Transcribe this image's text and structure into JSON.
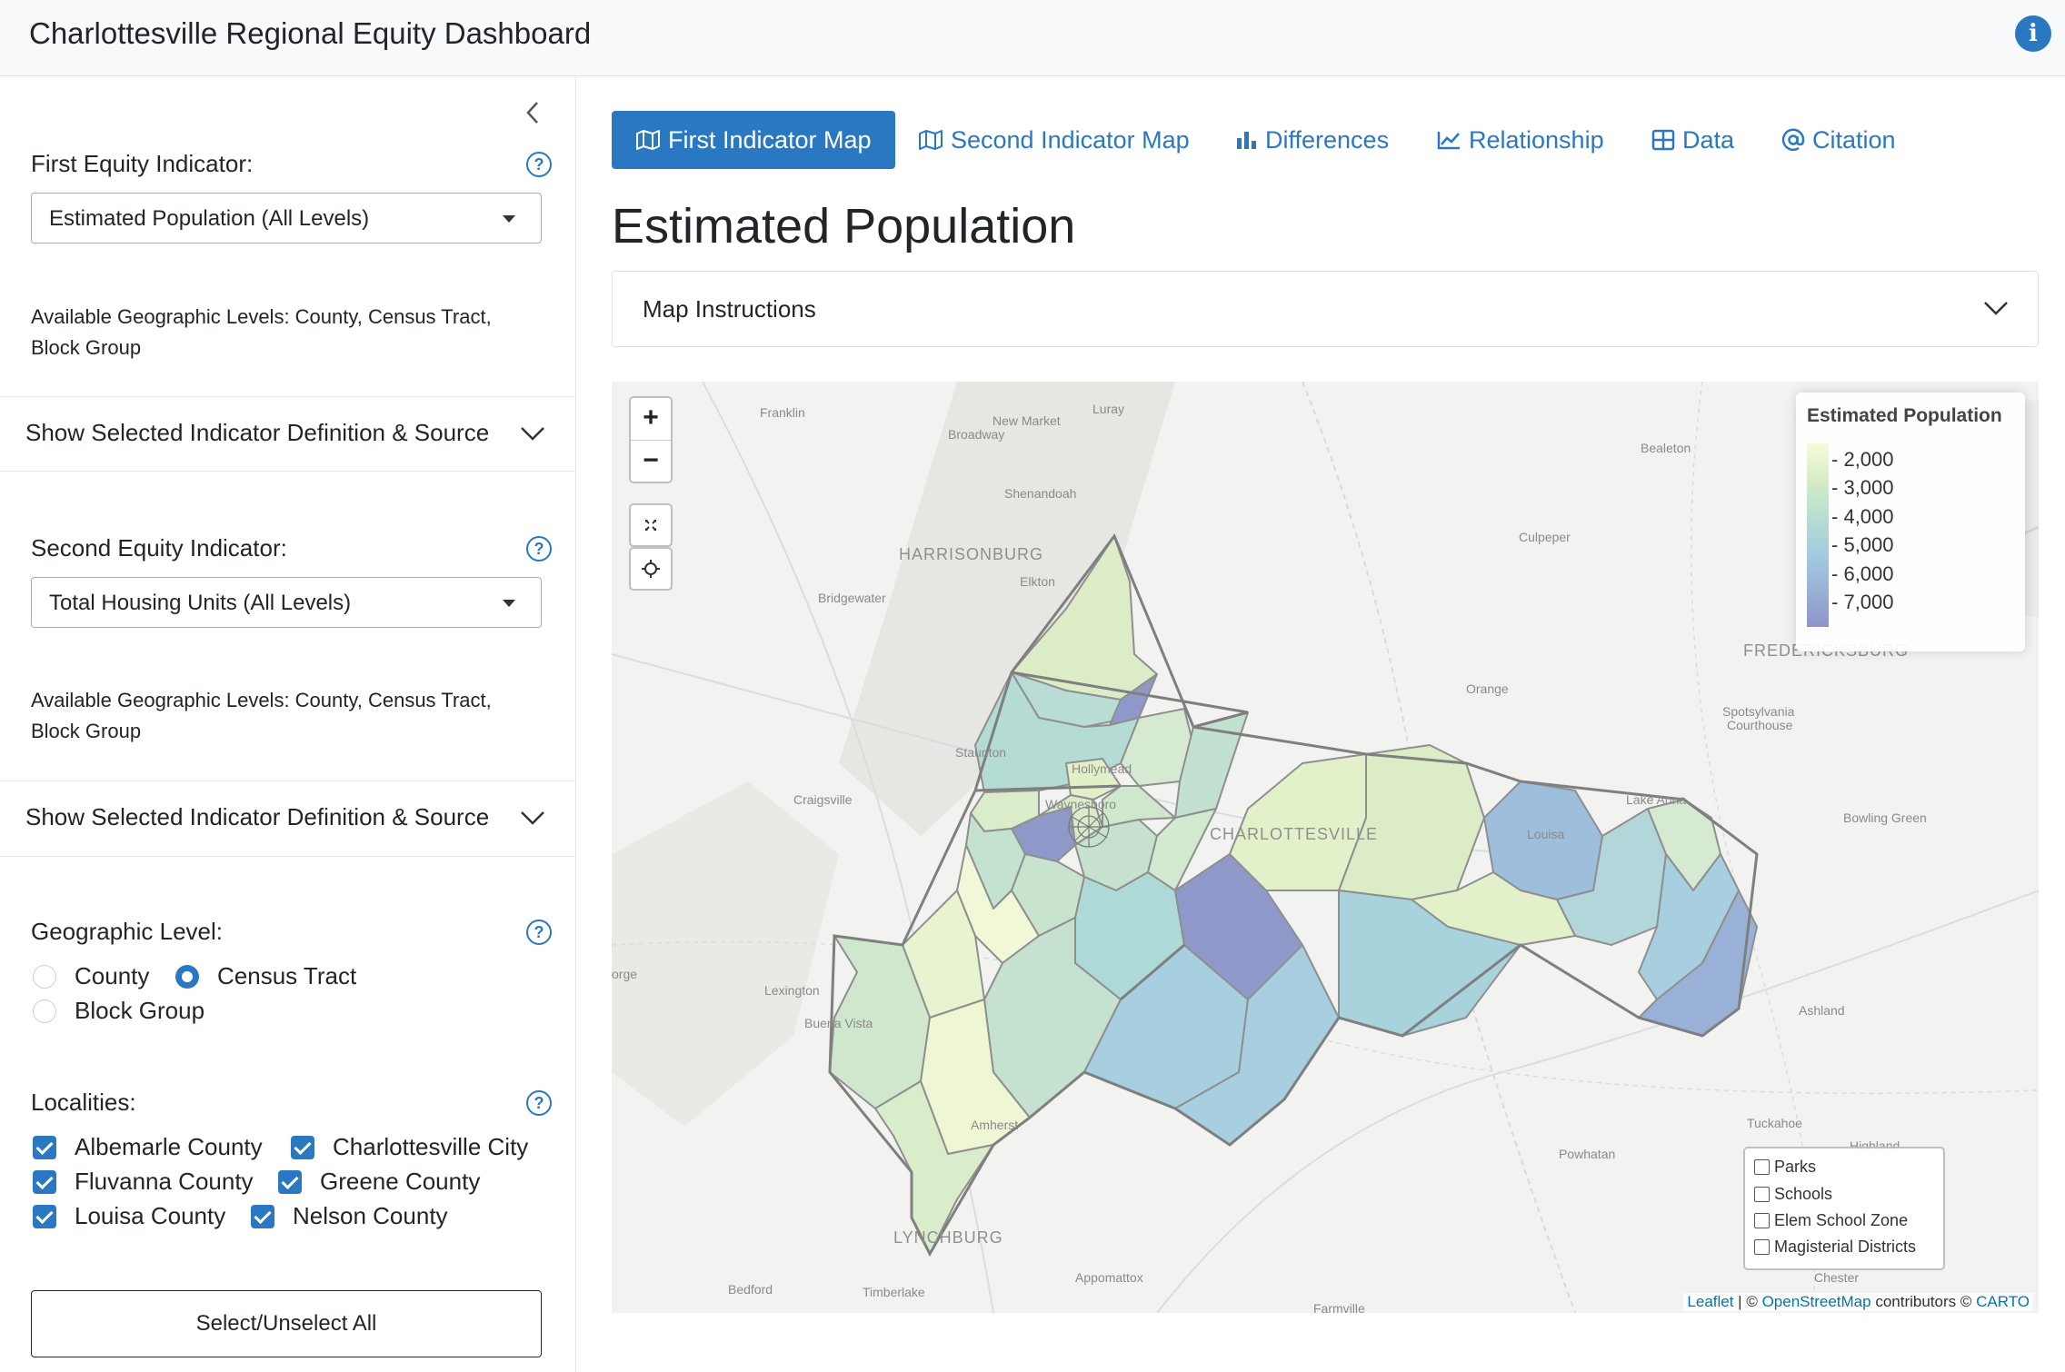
{
  "app_title": "Charlottesville Regional Equity Dashboard",
  "sidebar": {
    "first_indicator": {
      "label": "First Equity Indicator:",
      "selected": "Estimated Population (All Levels)",
      "available_line1": "Available Geographic Levels: County, Census Tract,",
      "available_line2": "Block Group",
      "definition_toggle": "Show Selected Indicator Definition & Source"
    },
    "second_indicator": {
      "label": "Second Equity Indicator:",
      "selected": "Total Housing Units (All Levels)",
      "available_line1": "Available Geographic Levels: County, Census Tract,",
      "available_line2": "Block Group",
      "definition_toggle": "Show Selected Indicator Definition & Source"
    },
    "geographic_level": {
      "label": "Geographic Level:",
      "options": [
        "County",
        "Census Tract",
        "Block Group"
      ],
      "selected": "Census Tract"
    },
    "localities": {
      "label": "Localities:",
      "items": [
        {
          "name": "Albemarle County",
          "checked": true
        },
        {
          "name": "Charlottesville City",
          "checked": true
        },
        {
          "name": "Fluvanna County",
          "checked": true
        },
        {
          "name": "Greene County",
          "checked": true
        },
        {
          "name": "Louisa County",
          "checked": true
        },
        {
          "name": "Nelson County",
          "checked": true
        }
      ],
      "select_all_label": "Select/Unselect All"
    }
  },
  "tabs": [
    {
      "label": "First Indicator Map",
      "icon": "map-icon",
      "active": true
    },
    {
      "label": "Second Indicator Map",
      "icon": "map-icon",
      "active": false
    },
    {
      "label": "Differences",
      "icon": "bar-chart-icon",
      "active": false
    },
    {
      "label": "Relationship",
      "icon": "line-chart-icon",
      "active": false
    },
    {
      "label": "Data",
      "icon": "table-icon",
      "active": false
    },
    {
      "label": "Citation",
      "icon": "at-icon",
      "active": false
    }
  ],
  "main": {
    "title": "Estimated Population",
    "instructions_label": "Map Instructions"
  },
  "map": {
    "zoom_in": "+",
    "zoom_out": "−",
    "legend": {
      "title": "Estimated Population",
      "ticks": [
        "2,000",
        "3,000",
        "4,000",
        "5,000",
        "6,000",
        "7,000"
      ],
      "colors": [
        "#f7fbd9",
        "#d5ecc4",
        "#b8dfd0",
        "#a4cbe0",
        "#9ab1d7",
        "#8d94c7"
      ]
    },
    "layers": [
      "Parks",
      "Schools",
      "Elem School Zone",
      "Magisterial Districts"
    ],
    "attribution": {
      "leaflet": "Leaflet",
      "sep": " | © ",
      "osm": "OpenStreetMap",
      "mid": " contributors © ",
      "carto": "CARTO"
    },
    "places": {
      "franklin": "Franklin",
      "new_market": "New Market",
      "luray": "Luray",
      "broadway": "Broadway",
      "bealeton": "Bealeton",
      "harrisonburg": "HARRISONBURG",
      "shenandoah": "Shenandoah",
      "culpeper": "Culpeper",
      "elkton": "Elkton",
      "bridgewater": "Bridgewater",
      "fredericksburg": "FREDERICKSBURG",
      "orange": "Orange",
      "spotsylvania": "Spotsylvania",
      "courthouse": "Courthouse",
      "staunton": "Staunton",
      "hollymead": "Hollymead",
      "craigsville": "Craigsville",
      "waynesboro": "Waynesboro",
      "charlottesville": "CHARLOTTESVILLE",
      "louisa": "Louisa",
      "lake_anna": "Lake Anna",
      "bowling_green": "Bowling Green",
      "orge": "orge",
      "lexington": "Lexington",
      "buena_vista": "Buena Vista",
      "ashland": "Ashland",
      "amherst": "Amherst",
      "tuckahoe": "Tuckahoe",
      "powhatan": "Powhatan",
      "highland": "Highland",
      "lynchburg": "LYNCHBURG",
      "bedford": "Bedford",
      "timberlake": "Timberlake",
      "appomattox": "Appomattox",
      "farmville": "Farmville",
      "chester": "Chester"
    }
  }
}
